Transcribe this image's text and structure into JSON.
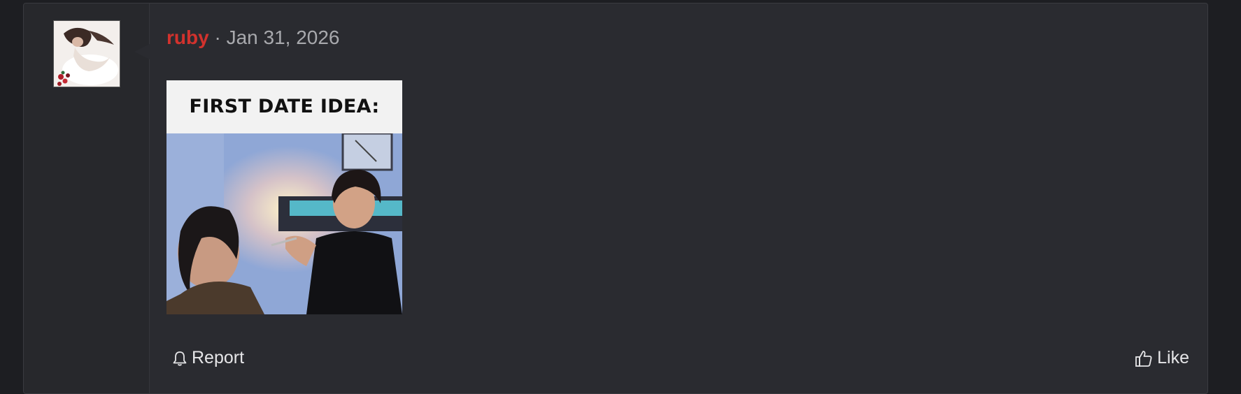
{
  "post": {
    "username": "ruby",
    "separator": "·",
    "date": "Jan 31, 2026",
    "image": {
      "caption": "FIRST DATE IDEA:"
    },
    "actions": {
      "report_label": "Report",
      "like_label": "Like"
    }
  },
  "icons": {
    "report": "bell-icon",
    "like": "thumbs-up-icon"
  },
  "colors": {
    "username": "#d2322d",
    "panel": "#2a2b30",
    "text": "#e6e6e8",
    "muted": "#a8a9ad"
  }
}
